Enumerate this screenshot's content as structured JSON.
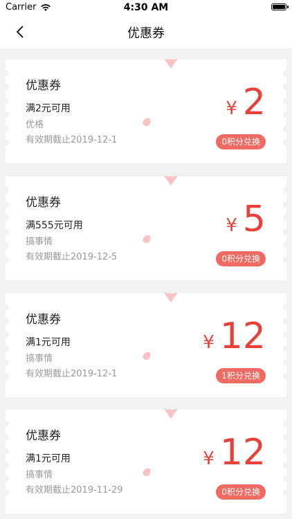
{
  "status": {
    "carrier": "Carrier",
    "time": "4:30 AM"
  },
  "nav": {
    "title": "优惠券"
  },
  "colors": {
    "accent": "#e8413b",
    "button": "#ef6a62",
    "petal": "#f7c3c9"
  },
  "coupons": [
    {
      "title": "优惠券",
      "condition": "满2元可用",
      "shop": "优格",
      "expiry": "有效期截止2019-12-1",
      "currency": "¥",
      "amount": "2",
      "button": "0积分兑换"
    },
    {
      "title": "优惠券",
      "condition": "满555元可用",
      "shop": "搞事情",
      "expiry": "有效期截止2019-12-5",
      "currency": "¥",
      "amount": "5",
      "button": "0积分兑换"
    },
    {
      "title": "优惠券",
      "condition": "满1元可用",
      "shop": "搞事情",
      "expiry": "有效期截止2019-12-1",
      "currency": "¥",
      "amount": "12",
      "button": "1积分兑换"
    },
    {
      "title": "优惠券",
      "condition": "满1元可用",
      "shop": "搞事情",
      "expiry": "有效期截止2019-11-29",
      "currency": "¥",
      "amount": "12",
      "button": "0积分兑换"
    }
  ]
}
